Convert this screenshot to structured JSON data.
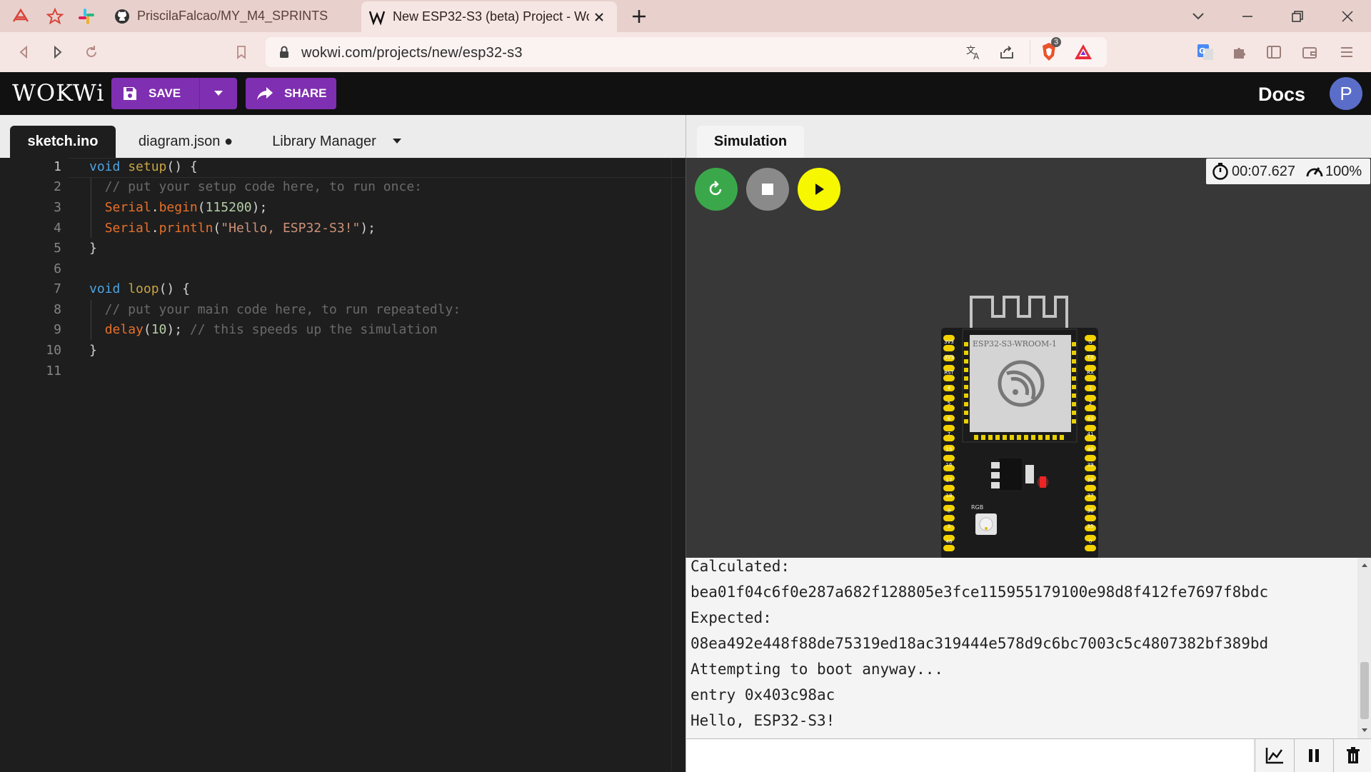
{
  "browser": {
    "tabs": [
      {
        "title": "PriscilaFalcao/MY_M4_SPRINTS",
        "icon": "github-icon"
      },
      {
        "title": "New ESP32-S3 (beta) Project - Wo",
        "icon": "wokwi-w-icon",
        "active": true
      }
    ],
    "url": "wokwi.com/projects/new/esp32-s3",
    "brave_badge": "3"
  },
  "header": {
    "logo": "WOKWi",
    "save_label": "SAVE",
    "share_label": "SHARE",
    "docs_label": "Docs",
    "avatar_letter": "P",
    "accent": "#7f2fb1"
  },
  "editor": {
    "tabs": [
      {
        "label": "sketch.ino",
        "active": true
      },
      {
        "label": "diagram.json ●"
      },
      {
        "label": "Library Manager"
      }
    ],
    "lines": [
      "void setup() {",
      "  // put your setup code here, to run once:",
      "  Serial.begin(115200);",
      "  Serial.println(\"Hello, ESP32-S3!\");",
      "}",
      "",
      "void loop() {",
      "  // put your main code here, to run repeatedly:",
      "  delay(10); // this speeds up the simulation",
      "}",
      ""
    ]
  },
  "simulation": {
    "tab_label": "Simulation",
    "elapsed_time": "00:07.627",
    "speed": "100%",
    "board_module_label": "ESP32-S3-WROOM-1",
    "rgb_label": "RGB",
    "left_pins": [
      "3V3",
      "3V3",
      "RST",
      "4",
      "5",
      "6",
      "7",
      "15",
      "16",
      "17",
      "18",
      "8",
      "3",
      "46"
    ],
    "right_pins": [
      "G",
      "TX",
      "RX",
      "1",
      "2",
      "42",
      "41",
      "40",
      "39",
      "38",
      "37",
      "36",
      "35",
      "0"
    ]
  },
  "serial": {
    "lines": [
      "Calculated:",
      "bea01f04c6f0e287a682f128805e3fce115955179100e98d8f412fe7697f8bdc",
      "Expected:",
      "08ea492e448f88de75319ed18ac319444e578d9c6bc7003c5c4807382bf389bd",
      "Attempting to boot anyway...",
      "entry 0x403c98ac",
      "Hello, ESP32-S3!"
    ]
  }
}
